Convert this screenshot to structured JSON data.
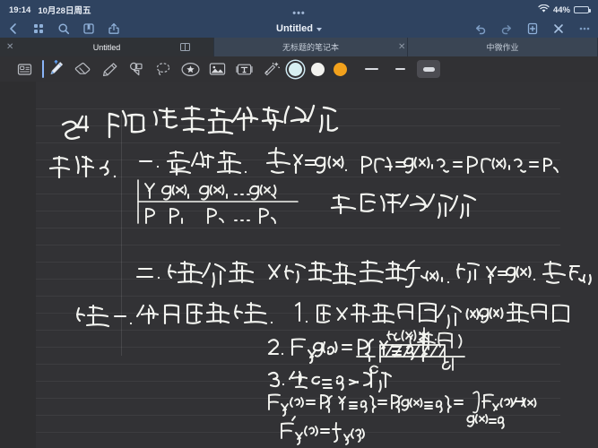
{
  "status_bar": {
    "time": "19:14",
    "date": "10月28日周五",
    "wifi_icon": "wifi-icon",
    "battery_percent": "44%",
    "battery_level": 44
  },
  "nav_bar": {
    "left_icons": [
      {
        "name": "back-icon",
        "label": "返回"
      },
      {
        "name": "thumbnails-grid-icon",
        "label": "页面缩略图"
      },
      {
        "name": "search-icon",
        "label": "搜索"
      },
      {
        "name": "bookmark-icon",
        "label": "书签"
      },
      {
        "name": "share-icon",
        "label": "共享"
      }
    ],
    "title": "Untitled",
    "title_chevron": "chevron-down-icon",
    "overflow_dots": "•••",
    "right_icons": [
      {
        "name": "undo-icon",
        "label": "撤销"
      },
      {
        "name": "redo-icon",
        "label": "重做"
      },
      {
        "name": "add-page-icon",
        "label": "添加页面"
      },
      {
        "name": "close-icon",
        "label": "关闭"
      },
      {
        "name": "more-icon",
        "label": "更多"
      }
    ]
  },
  "tab_bar": {
    "tabs": [
      {
        "label": "Untitled",
        "active": true,
        "closable": true
      },
      {
        "label": "无标题的笔记本",
        "active": false,
        "closable": true
      },
      {
        "label": "中微作业",
        "active": false,
        "closable": true
      }
    ],
    "split_view_icon": "split-view-icon",
    "close_icon": "close-icon"
  },
  "toolbar": {
    "tools": [
      {
        "name": "page-layout-icon",
        "label": "页面布局",
        "active": false
      },
      {
        "name": "pen-icon",
        "label": "钢笔",
        "active": true
      },
      {
        "name": "eraser-icon",
        "label": "橡皮擦",
        "active": false
      },
      {
        "name": "highlighter-icon",
        "label": "荧光笔",
        "active": false
      },
      {
        "name": "shapes-icon",
        "label": "形状",
        "active": false
      },
      {
        "name": "lasso-icon",
        "label": "套索",
        "active": false
      },
      {
        "name": "sticker-icon",
        "label": "贴纸",
        "active": false
      },
      {
        "name": "image-icon",
        "label": "图片",
        "active": false
      },
      {
        "name": "text-box-icon",
        "label": "文本框",
        "active": false
      },
      {
        "name": "magic-wand-icon",
        "label": "魔法笔",
        "active": false
      }
    ],
    "colors": [
      {
        "name": "color-swatch-cyan",
        "hex": "#d7f0f2",
        "selected": true
      },
      {
        "name": "color-swatch-white",
        "hex": "#f2f2ef",
        "selected": false
      },
      {
        "name": "color-swatch-orange",
        "hex": "#f2a11c",
        "selected": false
      }
    ],
    "stroke_widths": [
      {
        "name": "stroke-width-thin",
        "selected": false
      },
      {
        "name": "stroke-width-medium",
        "selected": false
      },
      {
        "name": "stroke-width-thick",
        "selected": true
      }
    ]
  },
  "note": {
    "paper_color": "#323235",
    "ink_color": "#f3f4f0",
    "title": "§4 随机变量函数的分布",
    "margin_label": "知识点.",
    "sections": [
      {
        "heading": "一. 离散型.",
        "formula": "求 Y = g(x).",
        "right_note_1": "P{Y = g(x₁)} = P{x = x₁} = P₁",
        "right_note_2": "再整理得最终分布律",
        "table": {
          "rows": [
            {
              "label": "Y",
              "cells": [
                "g(x₁),",
                "g(x₂)",
                "⋯",
                "g(xₙ)"
              ]
            },
            {
              "label": "P",
              "cells": [
                "P₁,",
                "P₂",
                "⋯",
                "Pₙ"
              ]
            }
          ]
        }
      },
      {
        "heading": "二. 连续型",
        "formula": "X的密度已知 f_X(x), 设 Y = g(x), 求 f_Y(y)",
        "method": "法一. 分布函数法.",
        "steps": [
          "1. 由x取值范围 得 y = g(x) 取值范围 (值域)",
          "2. F_Y(y) = P{Y ≤ y}",
          "3. 当 c ≤ y < d 时",
          "F_Y(y) = P{Y ≤ y} = P{g(x) ≤ y} = ∫_{g(x)≤y} f_X(x) dx",
          "F'_Y(y) = f_Y(y)"
        ],
        "diagram": {
          "label_top": "f_Y(y) ≠ 0",
          "label_left": "c",
          "label_right": "d"
        }
      }
    ]
  }
}
